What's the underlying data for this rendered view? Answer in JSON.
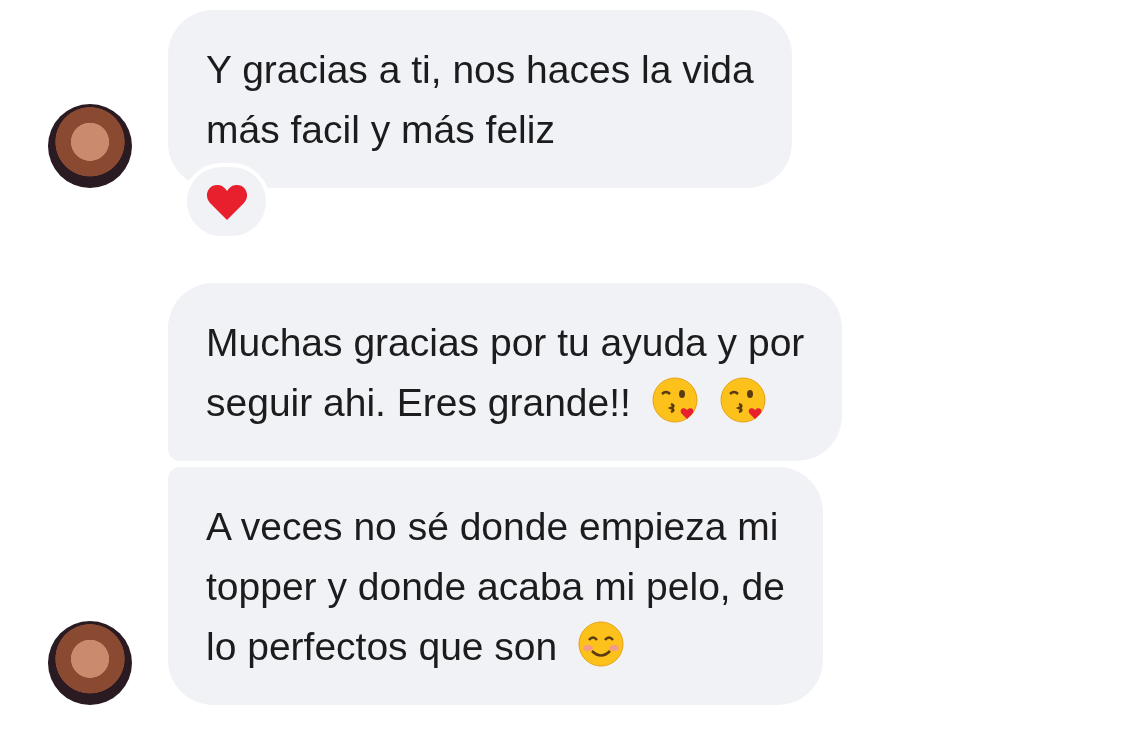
{
  "messages": [
    {
      "lines": [
        "Y gracias a ti, nos haces la vida",
        "más facil y más feliz"
      ],
      "avatar": true,
      "reaction": {
        "kind": "heart"
      }
    },
    {
      "lines": [
        "Muchas gracias por tu ayuda y por",
        "seguir ahi. Eres grande!!"
      ],
      "emojis": [
        {
          "kind": "kiss"
        },
        {
          "kind": "kiss"
        }
      ],
      "avatar": false
    },
    {
      "lines": [
        "A veces no sé donde empieza mi",
        "topper y donde acaba mi pelo, de",
        "lo perfectos que son"
      ],
      "emojis": [
        {
          "kind": "smile"
        }
      ],
      "avatar": true
    }
  ]
}
